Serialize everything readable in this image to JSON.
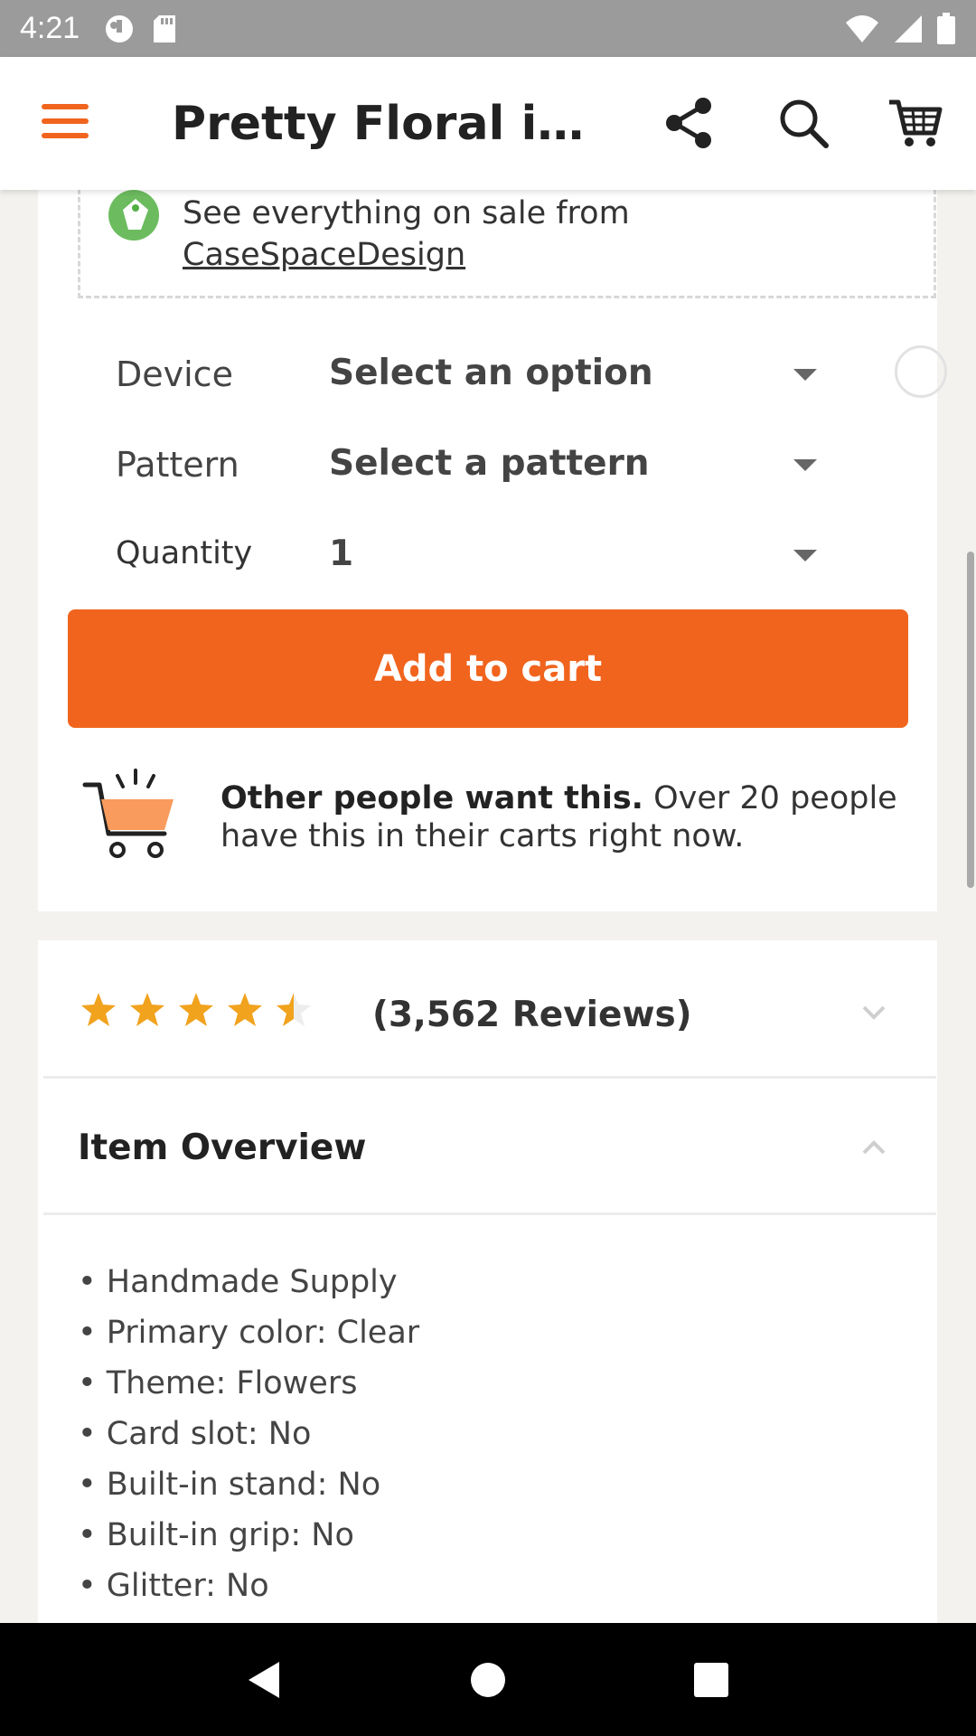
{
  "status_bar": {
    "time": "4:21",
    "icons": [
      "data-saver-icon",
      "sd-card-icon",
      "wifi-icon",
      "signal-icon",
      "battery-icon"
    ]
  },
  "app_bar": {
    "title": "Pretty Floral iPhone Case",
    "icons": [
      "menu-icon",
      "share-icon",
      "search-icon",
      "cart-icon"
    ],
    "accent_color": "#f1641e"
  },
  "sale_banner": {
    "text": "See everything on sale from",
    "shop_link": "CaseSpaceDesign",
    "icon": "sale-tag-icon",
    "icon_color": "#52b043"
  },
  "options": [
    {
      "label": "Device",
      "value": "Select an option"
    },
    {
      "label": "Pattern",
      "value": "Select a pattern"
    },
    {
      "label": "Quantity",
      "value": "1"
    }
  ],
  "add_to_cart": {
    "label": "Add to cart",
    "color": "#f1641e"
  },
  "cart_hint": {
    "bold": "Other people want this.",
    "rest": " Over 20 people have this in their carts right now.",
    "icon": "shopping-cart-icon"
  },
  "reviews": {
    "rating": 4.5,
    "max_rating": 5,
    "count_label": "(3,562 Reviews)",
    "star_color": "#f1a31e"
  },
  "item_overview": {
    "title": "Item Overview",
    "items": [
      "• Handmade Supply",
      "• Primary color: Clear",
      "• Theme: Flowers",
      "• Card slot: No",
      "• Built-in stand: No",
      "• Built-in grip: No",
      "• Glitter: No"
    ]
  },
  "nav_bar": {
    "buttons": [
      "back-icon",
      "home-icon",
      "recents-icon"
    ]
  }
}
